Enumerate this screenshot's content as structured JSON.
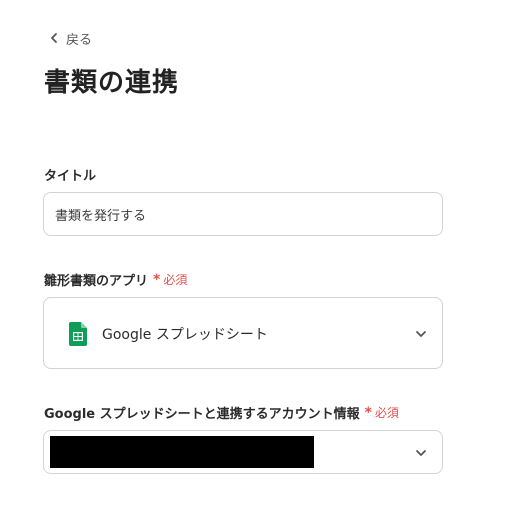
{
  "nav": {
    "back_label": "戻る"
  },
  "page": {
    "title": "書類の連携"
  },
  "fields": {
    "title": {
      "label": "タイトル",
      "value": "書類を発行する"
    },
    "template_app": {
      "label": "雛形書類のアプリ",
      "required_label": "必須",
      "selected": "Google スプレッドシート",
      "icon": "google-sheets-icon"
    },
    "account": {
      "label": "Google スプレッドシートと連携するアカウント情報",
      "required_label": "必須",
      "redacted": true
    }
  },
  "colors": {
    "required": "#e0524f",
    "sheets_green": "#0f9d58",
    "border": "#d3d3d3"
  }
}
